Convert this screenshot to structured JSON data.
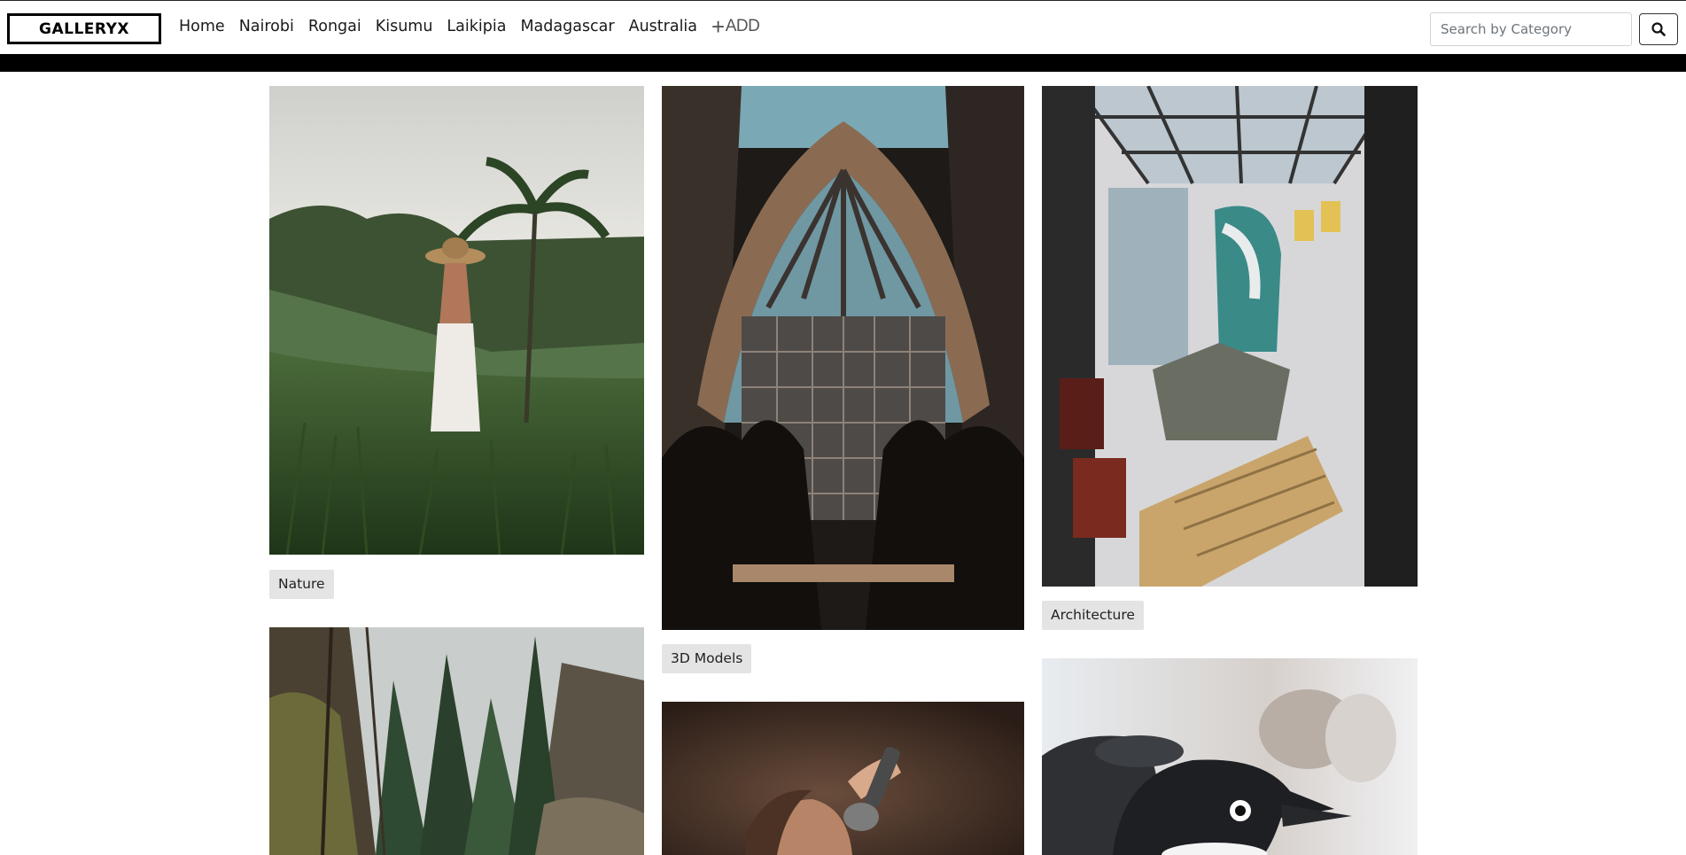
{
  "navbar": {
    "brand": "GALLERYX",
    "links": [
      "Home",
      "Nairobi",
      "Rongai",
      "Kisumu",
      "Laikipia",
      "Madagascar",
      "Australia"
    ],
    "add_label": "ADD",
    "add_icon": "plus-icon",
    "search_placeholder": "Search by Category",
    "search_value": "",
    "search_icon": "search-icon"
  },
  "gallery": {
    "cards": [
      {
        "subject": "woman in hat in rice terraces",
        "category": "Nature"
      },
      {
        "subject": "glass skyscraper with palm trees",
        "category": "3D Models"
      },
      {
        "subject": "atrium interior with mural",
        "category": "Architecture"
      },
      {
        "subject": "forest canyon",
        "category": ""
      },
      {
        "subject": "person holding microphone",
        "category": ""
      },
      {
        "subject": "penguins",
        "category": ""
      }
    ]
  },
  "colors": {
    "accent": "#000000",
    "tag_background": "#e4e4e4",
    "border": "#ced4da"
  }
}
